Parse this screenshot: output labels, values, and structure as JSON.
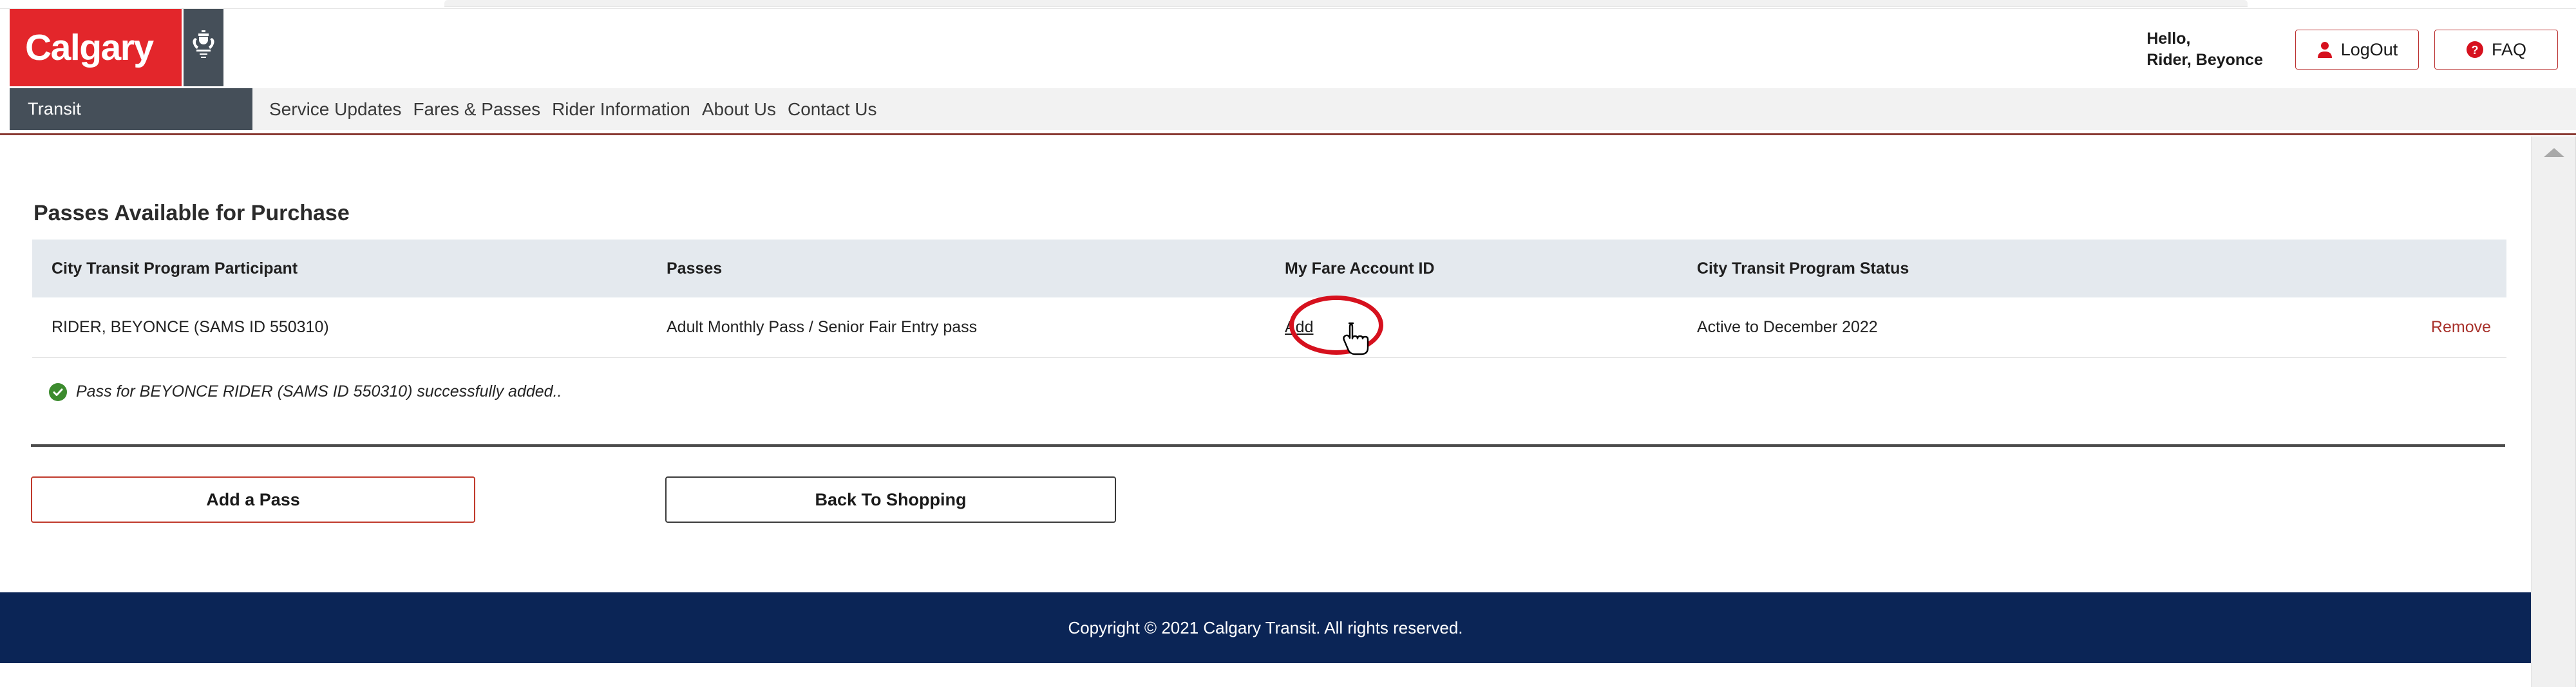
{
  "browser": {
    "tab_strip": ""
  },
  "brand": {
    "city": "Calgary",
    "department": "Transit",
    "crest_icon": "coat-of-arms-icon",
    "red": "#e3262b",
    "slate": "#454f59"
  },
  "nav": {
    "items": [
      {
        "label": "Service Updates"
      },
      {
        "label": "Fares & Passes"
      },
      {
        "label": "Rider Information"
      },
      {
        "label": "About Us"
      },
      {
        "label": "Contact Us"
      }
    ]
  },
  "user": {
    "greeting_line1": "Hello,",
    "greeting_line2": "Rider, Beyonce",
    "logout_label": "LogOut",
    "logout_icon": "user-icon",
    "faq_label": "FAQ",
    "faq_icon": "question-mark-icon"
  },
  "main": {
    "page_title": "Passes Available for Purchase",
    "table": {
      "headers": [
        "City Transit Program Participant",
        "Passes",
        "My Fare Account ID",
        "City Transit Program Status",
        ""
      ],
      "rows": [
        {
          "participant": "RIDER, BEYONCE (SAMS ID 550310)",
          "passes": "Adult Monthly Pass / Senior Fair Entry pass",
          "fare_account_id_link": "Add",
          "status": "Active to December 2022",
          "remove_link": "Remove"
        }
      ]
    },
    "success_message": "Pass for BEYONCE RIDER (SAMS ID 550310) successfully added..",
    "success_icon": "check-circle-icon",
    "buttons": {
      "add_pass": "Add a Pass",
      "back_to_shopping": "Back To Shopping"
    }
  },
  "annotation": {
    "highlight_target": "Add",
    "shape": "red-ellipse",
    "color": "#d6111e",
    "cursor_icon": "pointing-hand-cursor"
  },
  "footer": {
    "copyright": "Copyright © 2021 Calgary Transit. All rights reserved.",
    "background": "#0b2556"
  },
  "scrollbar": {
    "up_arrow_icon": "triangle-up-icon"
  }
}
